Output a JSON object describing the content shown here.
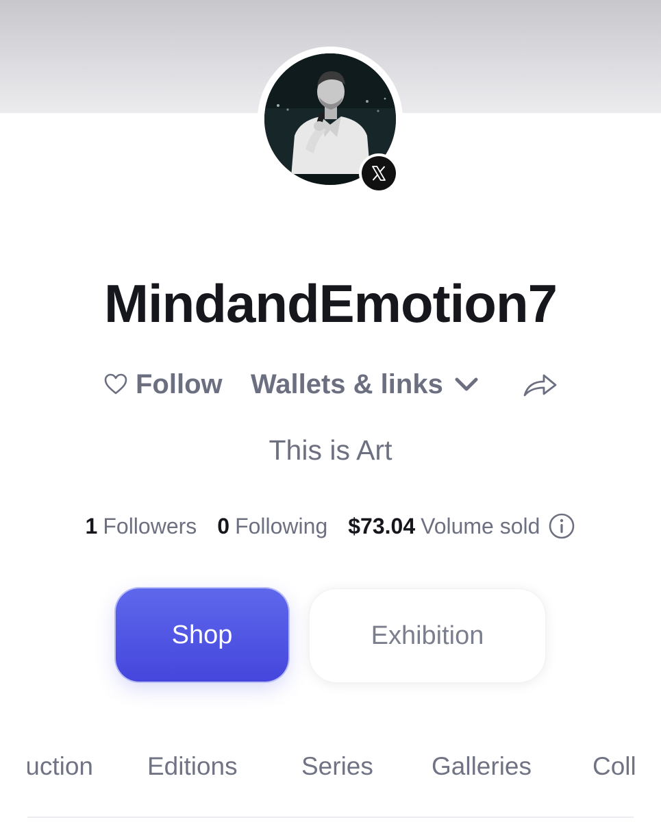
{
  "profile": {
    "username": "MindandEmotion7",
    "bio": "This is Art",
    "avatar_icon": "profile-photo",
    "badge_icon": "x-logo-icon"
  },
  "actions": {
    "follow_label": "Follow",
    "wallets_label": "Wallets & links",
    "follow_icon": "heart-icon",
    "wallets_icon": "chevron-down-icon",
    "share_icon": "share-icon"
  },
  "stats": {
    "followers_count": "1",
    "followers_label": "Followers",
    "following_count": "0",
    "following_label": "Following",
    "volume_value": "$73.04",
    "volume_label": "Volume sold",
    "info_icon": "info-icon"
  },
  "modes": {
    "shop_label": "Shop",
    "exhibition_label": "Exhibition",
    "active": "Shop",
    "accent_color": "#4f55e3"
  },
  "tabs": {
    "partial_left": "Auction",
    "items": [
      "Editions",
      "Series",
      "Galleries"
    ],
    "partial_right": "Collected"
  }
}
